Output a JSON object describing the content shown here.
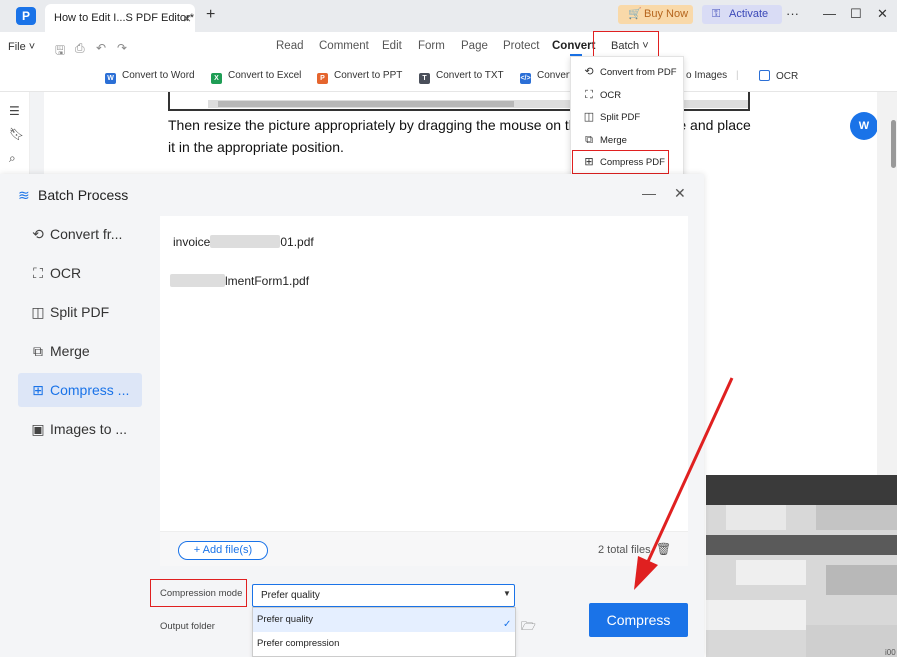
{
  "app": {
    "logo_letter": "P",
    "tab_title": "How to Edit I...S PDF Editor*",
    "tab_close": "×",
    "new_tab": "+",
    "buy_now": "Buy Now",
    "activate": "Activate",
    "more": "···",
    "minimize": "—",
    "maximize": "☐",
    "close": "✕"
  },
  "menubar": {
    "file": "File",
    "items": [
      "Read",
      "Comment",
      "Edit",
      "Form",
      "Page",
      "Protect",
      "Convert"
    ],
    "batch": "Batch"
  },
  "subtoolbar": {
    "items": [
      "Convert to Word",
      "Convert to Excel",
      "Convert to PPT",
      "Convert to TXT",
      "Convert",
      "o Images",
      "OCR"
    ]
  },
  "batch_menu": {
    "items": [
      "Convert from PDF",
      "OCR",
      "Split PDF",
      "Merge",
      "Compress PDF"
    ]
  },
  "document": {
    "line1": "Then resize the picture appropriately by dragging the mouse on the",
    "line1_end": "e and place",
    "line2": "it in the appropriate position.",
    "fab_label": "W"
  },
  "dialog": {
    "title": "Batch Process",
    "minimize": "—",
    "close": "✕",
    "sidebar": [
      {
        "label": "Convert fr..."
      },
      {
        "label": "OCR"
      },
      {
        "label": "Split PDF"
      },
      {
        "label": "Merge"
      },
      {
        "label": "Compress ..."
      },
      {
        "label": "Images to ..."
      }
    ],
    "files": [
      {
        "prefix": "invoice",
        "suffix": "01.pdf"
      },
      {
        "prefix": "",
        "suffix": "lmentForm1.pdf"
      }
    ],
    "add_files": "Add file(s)",
    "total_files": "2 total files",
    "compression_mode_label": "Compression mode",
    "output_folder_label": "Output folder",
    "compression_mode_value": "Prefer quality",
    "options": [
      "Prefer quality",
      "Prefer compression"
    ],
    "compress_button": "Compress"
  },
  "colors": {
    "accent": "#1a73e8",
    "annotation_red": "#e02020"
  },
  "corner_text": "i00"
}
